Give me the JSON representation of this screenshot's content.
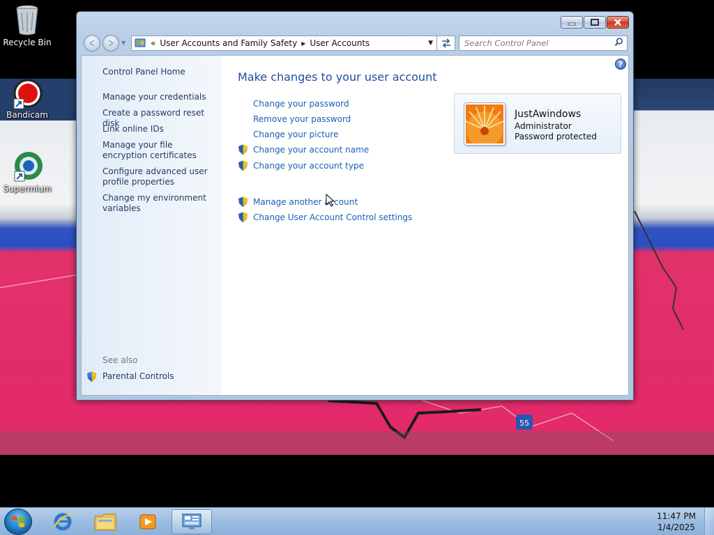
{
  "desktop": {
    "icons": [
      {
        "label": "Recycle Bin",
        "icon": "recycle-bin-icon"
      },
      {
        "label": "Bandicam",
        "icon": "bandicam-icon"
      },
      {
        "label": "Supermium",
        "icon": "supermium-icon"
      }
    ]
  },
  "window": {
    "breadcrumb": {
      "overflow": "«",
      "items": [
        "User Accounts and Family Safety",
        "User Accounts"
      ]
    },
    "search": {
      "placeholder": "Search Control Panel"
    },
    "sidebar": {
      "home": "Control Panel Home",
      "links": [
        "Manage your credentials",
        "Create a password reset disk",
        "Link online IDs",
        "Manage your file encryption certificates",
        "Configure advanced user profile properties",
        "Change my environment variables"
      ],
      "see_also_heading": "See also",
      "see_also": [
        "Parental Controls"
      ]
    },
    "main": {
      "title": "Make changes to your user account",
      "tasks": [
        {
          "label": "Change your password",
          "shield": false
        },
        {
          "label": "Remove your password",
          "shield": false
        },
        {
          "label": "Change your picture",
          "shield": false
        },
        {
          "label": "Change your account name",
          "shield": true
        },
        {
          "label": "Change your account type",
          "shield": true
        }
      ],
      "other_tasks": [
        {
          "label": "Manage another account",
          "shield": true
        },
        {
          "label": "Change User Account Control settings",
          "shield": true
        }
      ],
      "account": {
        "name": "JustAwindows",
        "role": "Administrator",
        "status": "Password protected"
      },
      "help": "?"
    }
  },
  "taskbar": {
    "apps": [
      "internet-explorer-icon",
      "windows-explorer-icon",
      "media-player-icon",
      "control-panel-icon"
    ],
    "clock": {
      "time": "11:47 PM",
      "date": "1/4/2025"
    }
  },
  "colors": {
    "link": "#1a5fb4",
    "title": "#1e4d9c",
    "wallpaper_pink": "#e3286a",
    "wallpaper_blue": "#2a4fc3"
  }
}
